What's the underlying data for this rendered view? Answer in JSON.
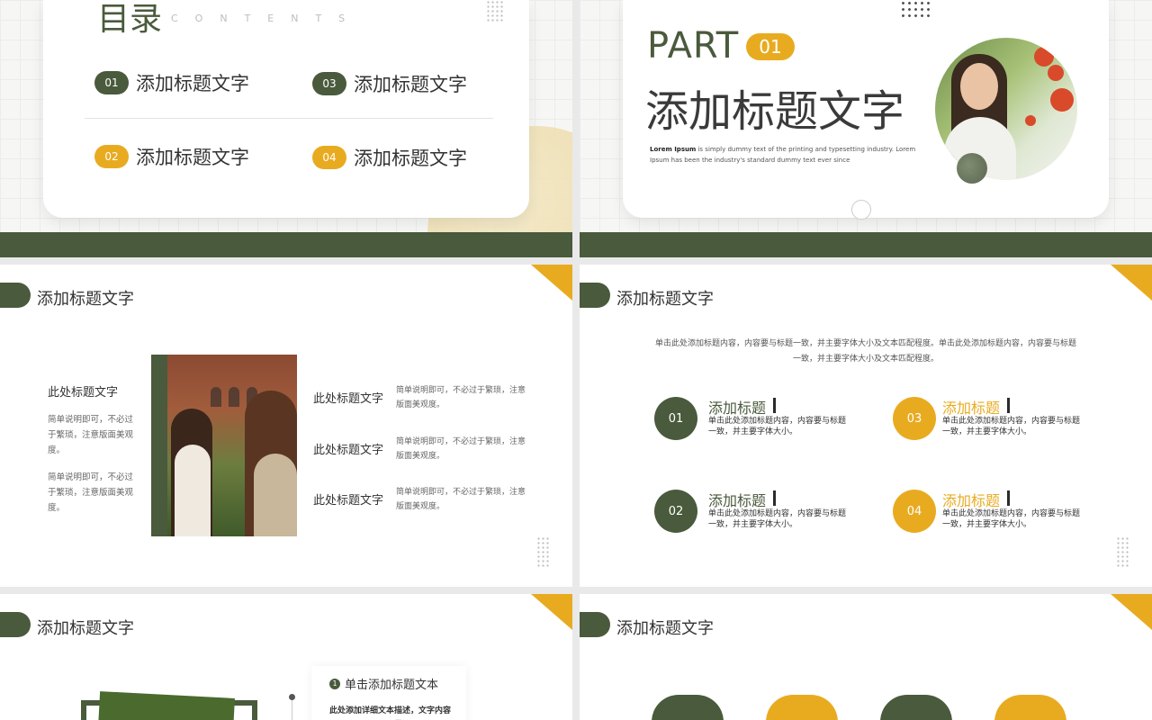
{
  "toc": {
    "title": "目录",
    "subtitle": "CONTENTS",
    "items": [
      {
        "num": "01",
        "label": "添加标题文字"
      },
      {
        "num": "02",
        "label": "添加标题文字"
      },
      {
        "num": "03",
        "label": "添加标题文字"
      },
      {
        "num": "04",
        "label": "添加标题文字"
      }
    ]
  },
  "part_slide": {
    "part_label": "PART",
    "part_num": "01",
    "title": "添加标题文字",
    "lorem_bold": "Lorem Ipsum",
    "lorem_rest": " is simply dummy text of the printing and typesetting industry. Lorem Ipsum has been the industry's standard dummy text ever since"
  },
  "slide3": {
    "header": "添加标题文字",
    "left_title": "此处标题文字",
    "left_desc_1": "简单说明即可，不必过于繁琐，注意版面美观度。",
    "left_desc_2": "简单说明即可，不必过于繁琐，注意版面美观度。",
    "rows": [
      {
        "title": "此处标题文字",
        "desc": "简单说明即可，不必过于繁琐，注意版面美观度。"
      },
      {
        "title": "此处标题文字",
        "desc": "简单说明即可，不必过于繁琐，注意版面美观度。"
      },
      {
        "title": "此处标题文字",
        "desc": "简单说明即可，不必过于繁琐，注意版面美观度。"
      }
    ]
  },
  "slide4": {
    "header": "添加标题文字",
    "intro": "单击此处添加标题内容，内容要与标题一致，并主要字体大小及文本匹配程度。单击此处添加标题内容，内容要与标题一致，并主要字体大小及文本匹配程度。",
    "items": [
      {
        "num": "01",
        "title": "添加标题",
        "desc": "单击此处添加标题内容，内容要与标题一致，并主要字体大小。"
      },
      {
        "num": "02",
        "title": "添加标题",
        "desc": "单击此处添加标题内容，内容要与标题一致，并主要字体大小。"
      },
      {
        "num": "03",
        "title": "添加标题",
        "desc": "单击此处添加标题内容，内容要与标题一致，并主要字体大小。"
      },
      {
        "num": "04",
        "title": "添加标题",
        "desc": "单击此处添加标题内容，内容要与标题一致，并主要字体大小。"
      }
    ]
  },
  "slide5": {
    "header": "添加标题文字",
    "card_num": "1",
    "card_title": "单击添加标题文本",
    "card_desc": "此处添加详细文本描述，文字内容建议与标题相关尽量简洁"
  },
  "slide6": {
    "header": "添加标题文字"
  },
  "colors": {
    "green": "#4a5a3c",
    "yellow": "#e8ab20"
  }
}
